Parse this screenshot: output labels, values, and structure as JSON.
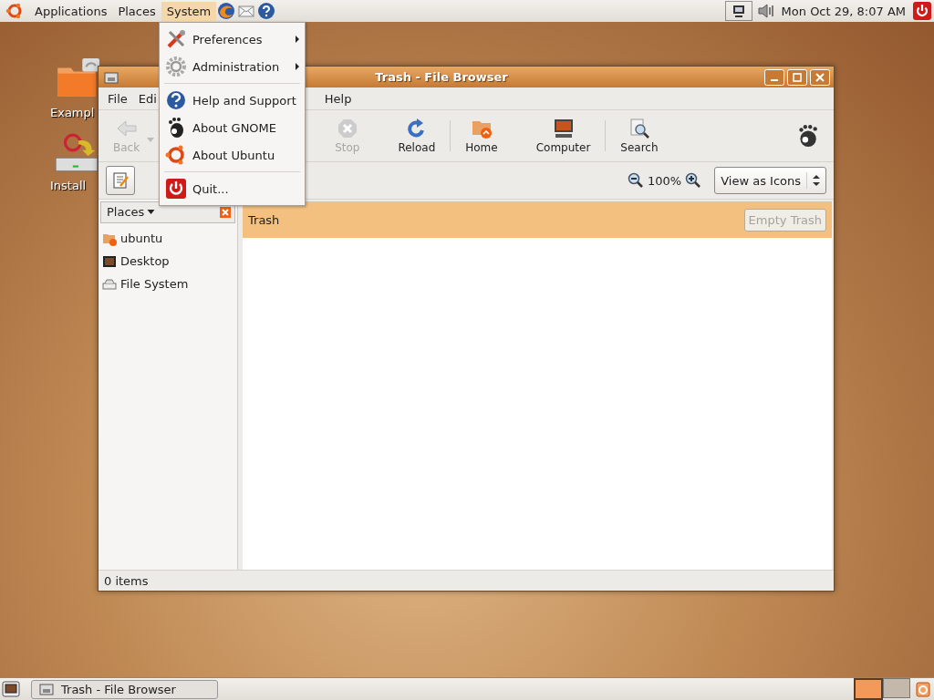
{
  "top_panel": {
    "menus": [
      {
        "label": "Applications",
        "selected": false
      },
      {
        "label": "Places",
        "selected": false
      },
      {
        "label": "System",
        "selected": true
      }
    ],
    "clock": "Mon Oct 29,  8:07 AM"
  },
  "desktop_icons": [
    {
      "label": "Exampl",
      "kind": "folder"
    },
    {
      "label": "Install",
      "kind": "installer"
    }
  ],
  "window": {
    "title": "Trash - File Browser",
    "menubar": [
      "File",
      "Edi",
      "Help"
    ],
    "toolbar": [
      {
        "label": "Back",
        "disabled": true
      },
      {
        "label": "Stop",
        "disabled": true
      },
      {
        "label": "Reload",
        "disabled": false
      },
      {
        "label": "Home",
        "disabled": false
      },
      {
        "label": "Computer",
        "disabled": false
      },
      {
        "label": "Search",
        "disabled": false
      }
    ],
    "zoom": "100%",
    "view_select": "View as Icons",
    "sidebar": {
      "header": "Places",
      "items": [
        "ubuntu",
        "Desktop",
        "File System"
      ]
    },
    "location": {
      "title": "Trash",
      "button": {
        "label": "Empty Trash",
        "disabled": true
      }
    },
    "status_bar": "0 items"
  },
  "system_menu": [
    {
      "kind": "item",
      "label": "Preferences",
      "submenu": true
    },
    {
      "kind": "item",
      "label": "Administration",
      "submenu": true
    },
    {
      "kind": "separator"
    },
    {
      "kind": "item",
      "label": "Help and Support",
      "submenu": false
    },
    {
      "kind": "item",
      "label": "About GNOME",
      "submenu": false
    },
    {
      "kind": "item",
      "label": "About Ubuntu",
      "submenu": false
    },
    {
      "kind": "separator"
    },
    {
      "kind": "item",
      "label": "Quit...",
      "submenu": false
    }
  ],
  "bottom_panel": {
    "tasks": [
      "Trash - File Browser"
    ],
    "workspaces": [
      {
        "selected": true
      },
      {
        "selected": false
      }
    ]
  }
}
